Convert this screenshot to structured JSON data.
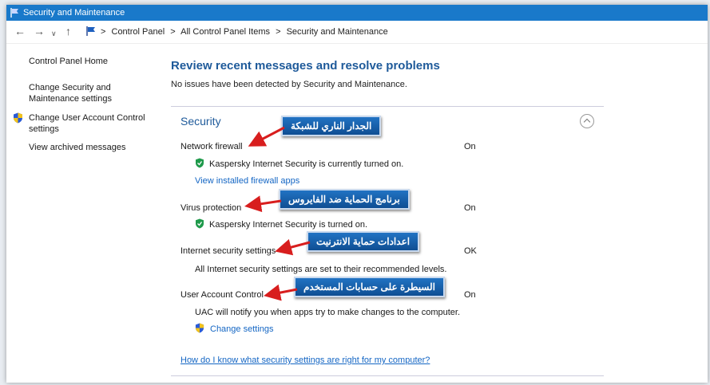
{
  "window": {
    "title": "Security and Maintenance"
  },
  "address_bar": {
    "breadcrumbs": [
      "Control Panel",
      "All Control Panel Items",
      "Security and Maintenance"
    ],
    "separator": ">"
  },
  "sidebar": {
    "items": [
      {
        "label": "Control Panel Home"
      },
      {
        "label_line1": "Change Security and",
        "label_line2": "Maintenance settings"
      },
      {
        "label_line1": "Change User Account Control",
        "label_line2": "settings"
      },
      {
        "label": "View archived messages"
      }
    ]
  },
  "main": {
    "heading": "Review recent messages and resolve problems",
    "subtext": "No issues have been detected by Security and Maintenance.",
    "security": {
      "title": "Security",
      "rows": [
        {
          "label": "Network firewall",
          "status": "On",
          "detail": "Kaspersky Internet Security is currently turned on.",
          "link": "View installed firewall apps"
        },
        {
          "label": "Virus protection",
          "status": "On",
          "detail": "Kaspersky Internet Security is turned on."
        },
        {
          "label": "Internet security settings",
          "status": "OK",
          "detail": "All Internet security settings are set to their recommended levels."
        },
        {
          "label": "User Account Control",
          "status": "On",
          "detail": "UAC will notify you when apps try to make changes to the computer.",
          "link": "Change settings"
        }
      ],
      "help_link": "How do I know what security settings are right for my computer?"
    }
  },
  "callouts": [
    "الجدار الناري للشبكة",
    "برنامج الحماية ضد الفايروس",
    "اعدادات حماية الانترنيت",
    "السيطرة على حسابات المستخدم"
  ],
  "colors": {
    "titlebar": "#1979ca",
    "link": "#1466c4",
    "heading": "#1e5a9a",
    "arrow": "#d81e1e",
    "callout": "#1a62ad"
  }
}
